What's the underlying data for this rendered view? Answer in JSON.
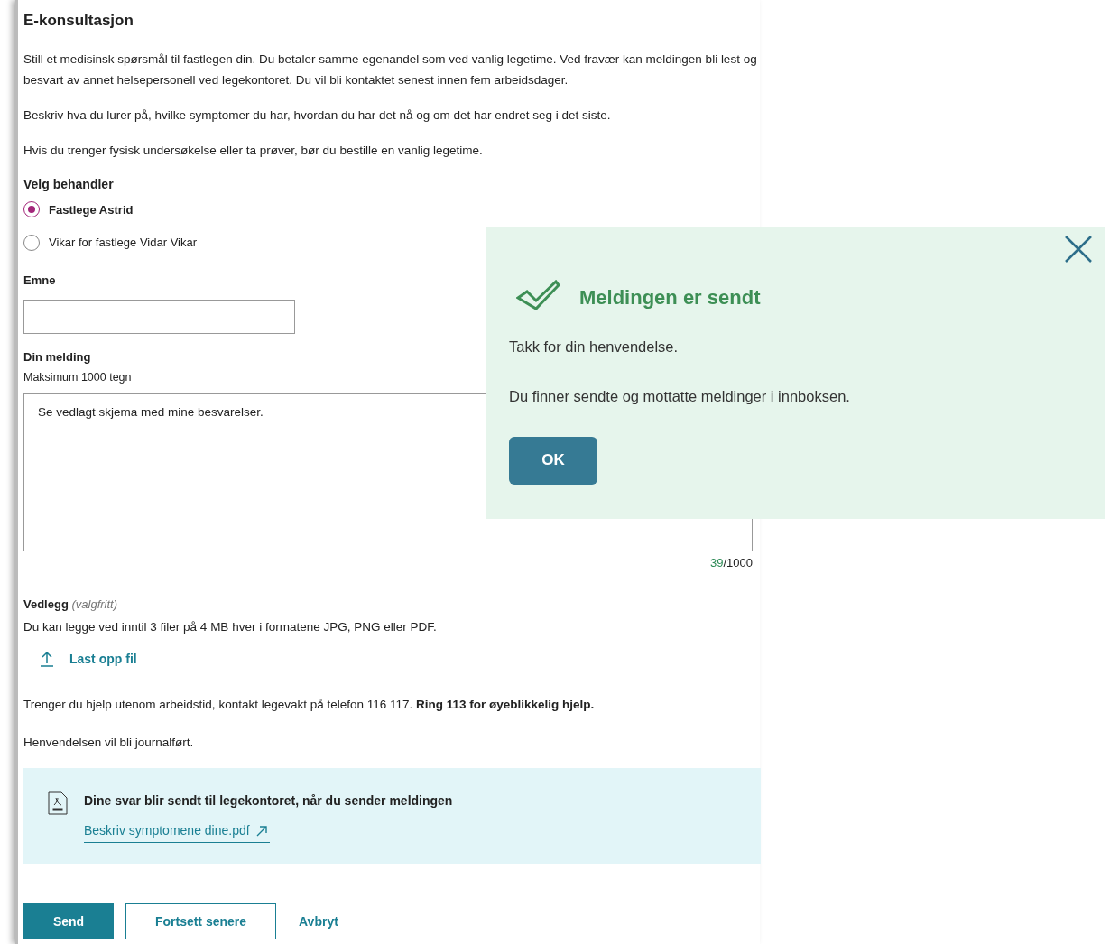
{
  "title": "E-konsultasjon",
  "intro": [
    "Still et medisinsk spørsmål til fastlegen din. Du betaler samme egenandel som ved vanlig legetime. Ved fravær kan meldingen bli lest og besvart av annet helsepersonell ved legekontoret. Du vil bli kontaktet senest innen fem arbeidsdager.",
    "Beskriv hva du lurer på, hvilke symptomer du har, hvordan du har det nå og om det har endret seg i det siste.",
    "Hvis du trenger fysisk undersøkelse eller ta prøver, bør du bestille en vanlig legetime."
  ],
  "practitioner": {
    "label": "Velg behandler",
    "options": [
      {
        "label": "Fastlege Astrid",
        "selected": true
      },
      {
        "label": "Vikar for fastlege Vidar Vikar",
        "selected": false
      }
    ]
  },
  "subject": {
    "label": "Emne"
  },
  "message": {
    "label": "Din melding",
    "hint": "Maksimum 1000 tegn",
    "value": "Se vedlagt skjema med mine besvarelser.",
    "count": "39",
    "max": "/1000"
  },
  "attachments": {
    "label": "Vedlegg",
    "optional": "(valgfritt)",
    "description": "Du kan legge ved inntil 3 filer på 4 MB hver i formatene JPG, PNG eller PDF.",
    "upload": "Last opp fil"
  },
  "help_text": "Trenger du hjelp utenom arbeidstid, kontakt legevakt på telefon 116 117. **Ring 113 for øyeblikkelig hjelp.**",
  "journal_note": "Henvendelsen vil bli journalført.",
  "info_box": {
    "text": "Dine svar blir sendt til legekontoret, når du sender meldingen",
    "link": "Beskriv symptomene dine.pdf"
  },
  "buttons": [
    {
      "label": "Send",
      "kind": "primary"
    },
    {
      "label": "Fortsett senere",
      "kind": "secondary"
    },
    {
      "label": "Avbryt",
      "kind": "link"
    }
  ],
  "dialog": {
    "title": "Meldingen er sendt",
    "lines": [
      "Takk for din henvendelse.",
      "Du finner sendte og mottatte meldinger i innboksen."
    ],
    "ok": "OK"
  }
}
